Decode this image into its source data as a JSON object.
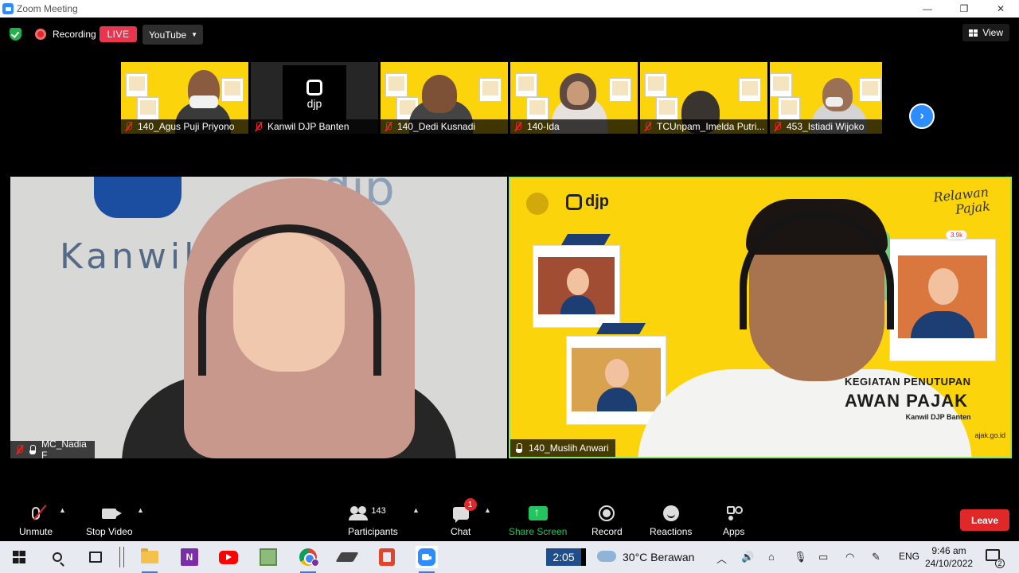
{
  "window": {
    "title": "Zoom Meeting",
    "minimize": "—",
    "maximize": "❐",
    "close": "✕"
  },
  "topbar": {
    "recording_label": "Recording",
    "live_label": "LIVE",
    "stream_target": "YouTube",
    "view_label": "View"
  },
  "participants_strip": [
    {
      "name": "140_Agus Puji Priyono",
      "muted": true,
      "video": true
    },
    {
      "name": "Kanwil DJP Banten",
      "muted": true,
      "video": false,
      "logo_text": "djp"
    },
    {
      "name": "140_Dedi Kusnadi",
      "muted": true,
      "video": true
    },
    {
      "name": "140-Ida",
      "muted": true,
      "video": true
    },
    {
      "name": "TCUnpam_Imelda Putri...",
      "muted": true,
      "video": true
    },
    {
      "name": "453_Istiadi Wijoko",
      "muted": true,
      "video": true
    }
  ],
  "main_tiles": {
    "left": {
      "name": "MC_Nadia F",
      "wall_text": "Kanwil   Banten",
      "wall_brand": "djp"
    },
    "right": {
      "name": "140_Muslih Anwari",
      "brand": "djp",
      "script_title": "Relawan Pajak",
      "event_line1": "KEGIATAN PENUTUPAN",
      "event_line2": "AWAN PAJAK",
      "event_line3": "Kanwil DJP Banten",
      "url": "ajak.go.id",
      "like_badge": "3.9k"
    }
  },
  "toolbar": {
    "unmute": "Unmute",
    "stop_video": "Stop Video",
    "participants": "Participants",
    "participants_count": "143",
    "chat": "Chat",
    "chat_badge": "1",
    "share_screen": "Share Screen",
    "record": "Record",
    "reactions": "Reactions",
    "apps": "Apps",
    "leave": "Leave"
  },
  "taskbar": {
    "clock_widget": "2:05",
    "weather": "30°C  Berawan",
    "language": "ENG",
    "time": "9:46 am",
    "date": "24/10/2022",
    "notifications": "2",
    "onenote_letter": "N"
  }
}
